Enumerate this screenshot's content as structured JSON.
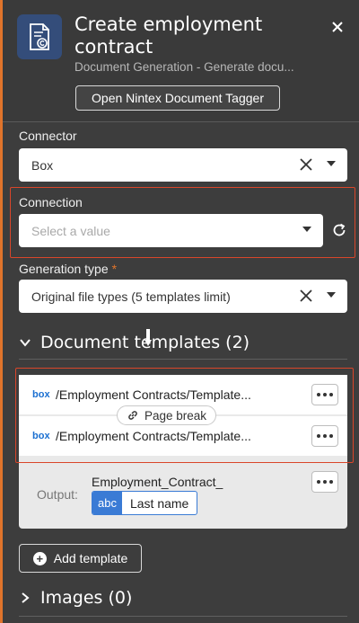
{
  "header": {
    "title": "Create employment contract",
    "subtitle": "Document Generation - Generate docu...",
    "tagger_button": "Open Nintex Document Tagger",
    "icon": "document-copyright-icon",
    "accent_color": "#e0742b"
  },
  "connector": {
    "label": "Connector",
    "value": "Box"
  },
  "connection": {
    "label": "Connection",
    "placeholder": "Select a value"
  },
  "generation_type": {
    "label": "Generation type",
    "required_mark": "*",
    "value": "Original file types (5 templates limit)"
  },
  "document_templates": {
    "heading": "Document templates (2)",
    "items": [
      {
        "logo": "box",
        "path": "/Employment Contracts/Template..."
      },
      {
        "logo": "box",
        "path": "/Employment Contracts/Template..."
      }
    ],
    "page_break_label": "Page break",
    "output_label": "Output:",
    "output_name": "Employment_Contract_",
    "output_chip_type": "abc",
    "output_chip_value": "Last name",
    "add_template": "Add template"
  },
  "images": {
    "heading": "Images (0)"
  },
  "colors": {
    "highlight": "#d9462a",
    "box_blue": "#1a6fd1",
    "chip_blue": "#3a7bd5"
  }
}
